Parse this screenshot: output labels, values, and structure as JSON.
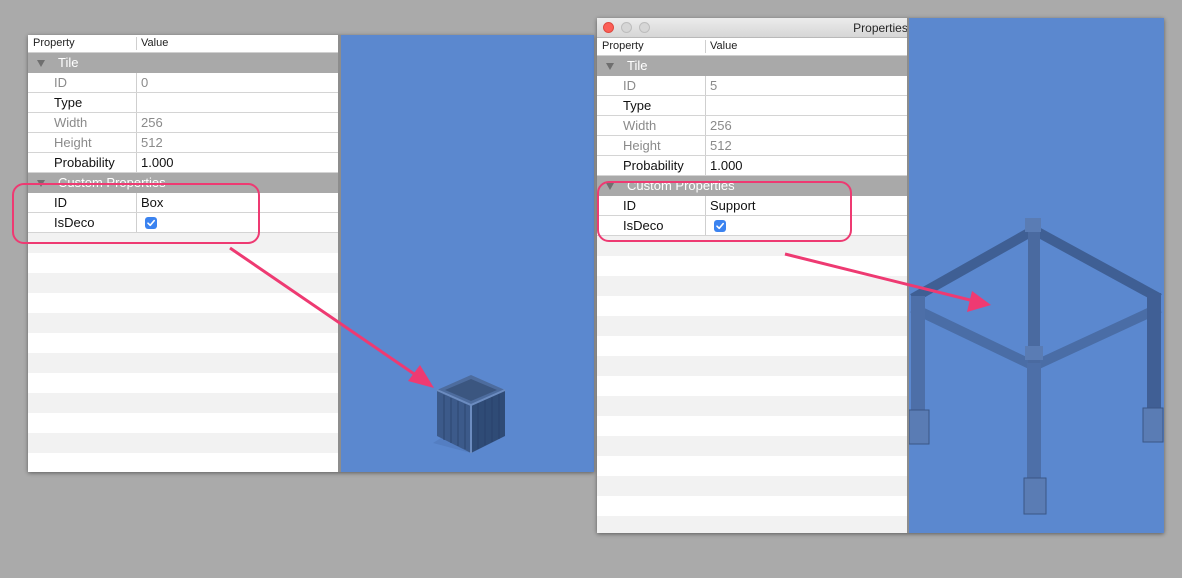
{
  "left_panel": {
    "header": {
      "property": "Property",
      "value": "Value"
    },
    "tile_group": "Tile",
    "tile_rows": [
      {
        "key": "ID",
        "value": "0"
      },
      {
        "key": "Type",
        "value": ""
      },
      {
        "key": "Width",
        "value": "256"
      },
      {
        "key": "Height",
        "value": "512"
      },
      {
        "key": "Probability",
        "value": "1.000"
      }
    ],
    "custom_group": "Custom Properties",
    "custom_rows": [
      {
        "key": "ID",
        "value": "Box"
      },
      {
        "key": "IsDeco",
        "checked": true
      }
    ]
  },
  "right_panel": {
    "window_title": "Properties",
    "header": {
      "property": "Property",
      "value": "Value"
    },
    "tile_group": "Tile",
    "tile_rows": [
      {
        "key": "ID",
        "value": "5"
      },
      {
        "key": "Type",
        "value": ""
      },
      {
        "key": "Width",
        "value": "256"
      },
      {
        "key": "Height",
        "value": "512"
      },
      {
        "key": "Probability",
        "value": "1.000"
      }
    ],
    "custom_group": "Custom Properties",
    "custom_rows": [
      {
        "key": "ID",
        "value": "Support"
      },
      {
        "key": "IsDeco",
        "checked": true
      }
    ]
  },
  "colors": {
    "highlight": "#ee3a72",
    "canvas": "#5b88cf",
    "group_row": "#a9a9a9",
    "checkbox": "#3b83f0"
  },
  "icons": [
    "close-icon",
    "minimize-icon",
    "zoom-icon",
    "disclosure-triangle-icon",
    "checkmark-icon",
    "box-tile-icon",
    "support-tile-icon"
  ]
}
